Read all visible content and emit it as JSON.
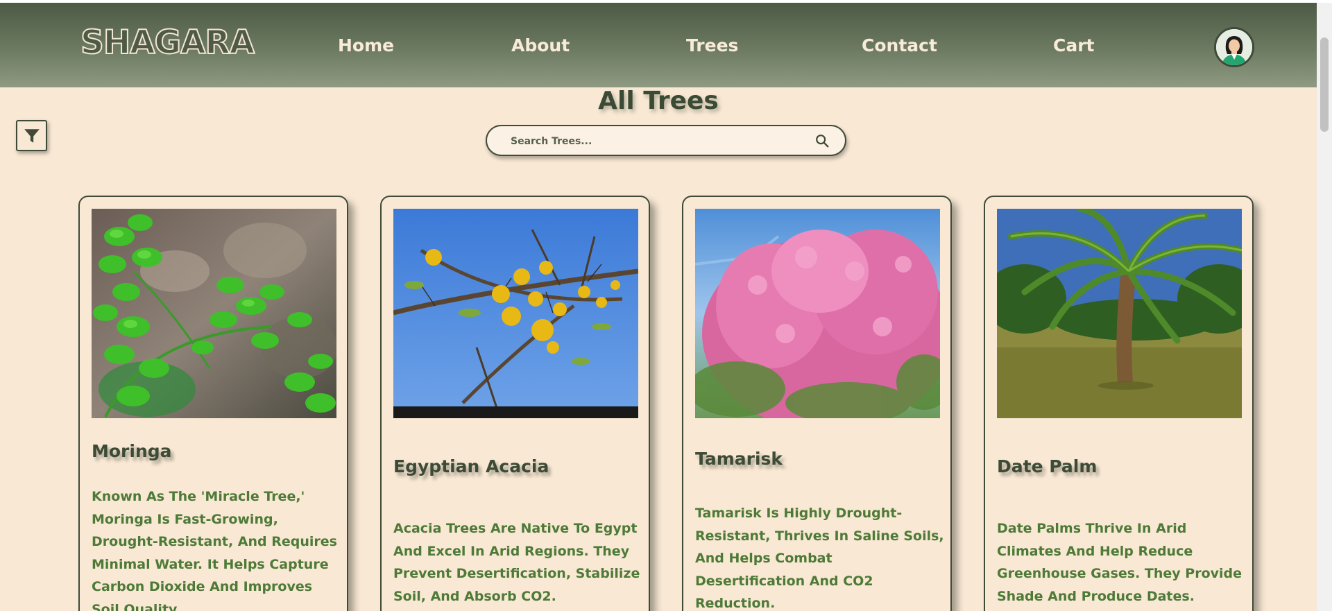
{
  "header": {
    "logo": "SHAGARA",
    "nav": [
      {
        "label": "Home"
      },
      {
        "label": "About"
      },
      {
        "label": "Trees"
      },
      {
        "label": "Contact"
      },
      {
        "label": "Cart"
      }
    ]
  },
  "main": {
    "title": "All Trees",
    "search": {
      "placeholder": "Search Trees...",
      "value": ""
    }
  },
  "trees": [
    {
      "name": "Moringa",
      "description": "Known As The 'Miracle Tree,' Moringa Is Fast-Growing, Drought-Resistant, And Requires Minimal Water. It Helps Capture Carbon Dioxide And Improves Soil Quality."
    },
    {
      "name": "Egyptian Acacia",
      "description": "Acacia Trees Are Native To Egypt And Excel In Arid Regions. They Prevent Desertification, Stabilize Soil, And Absorb CO2."
    },
    {
      "name": "Tamarisk",
      "description": "Tamarisk Is Highly Drought-Resistant, Thrives In Saline Soils, And Helps Combat Desertification And CO2 Reduction."
    },
    {
      "name": "Date Palm",
      "description": "Date Palms Thrive In Arid Climates And Help Reduce Greenhouse Gases. They Provide Shade And Produce Dates."
    }
  ],
  "colors": {
    "accent": "#3f4a38",
    "text_green": "#4e7a37",
    "background": "#f8e8d4"
  }
}
